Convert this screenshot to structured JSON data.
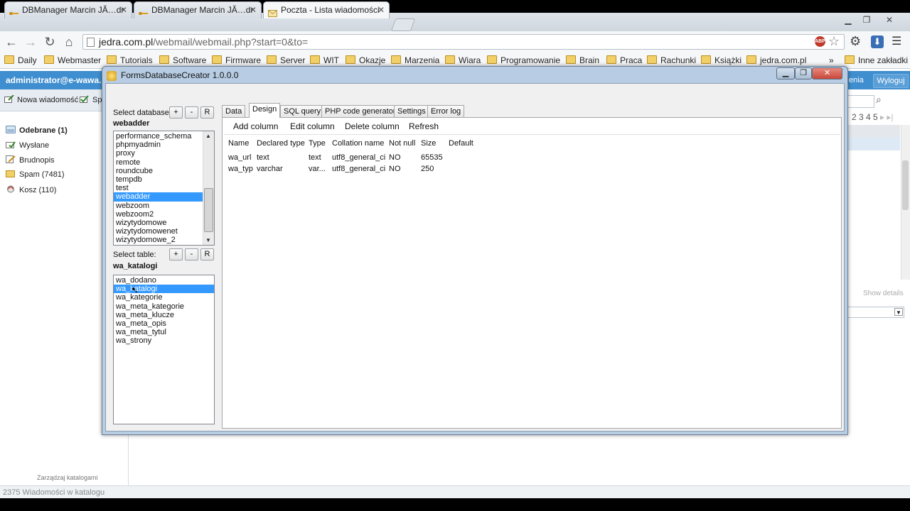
{
  "browser": {
    "tabs": [
      {
        "title": "DBManager Marcin JĂ…dr",
        "active": false
      },
      {
        "title": "DBManager Marcin JĂ…dr",
        "active": false
      },
      {
        "title": "Poczta - Lista wiadomości",
        "active": true
      }
    ],
    "url_host": "jedra.com.pl",
    "url_path": "/webmail/webmail.php?start=0&to=",
    "bookmarks": [
      "Daily",
      "Webmaster",
      "Tutorials",
      "Software",
      "Firmware",
      "Server",
      "WIT",
      "Okazje",
      "Marzenia",
      "Wiara",
      "Programowanie",
      "Brain",
      "Praca",
      "Rachunki",
      "Książki",
      "jedra.com.pl"
    ],
    "bookmarks_more": "»",
    "bookmarks_other": "Inne zakładki"
  },
  "webmail": {
    "account": "administrator@e-wawa.p",
    "logout": "Wyloguj",
    "settings_fragment": "enia",
    "new_message": "Nowa wiadomość",
    "send_fragment": "Sp",
    "folders": [
      {
        "label": "Odebrane (1)",
        "bold": true,
        "icon": "inbox-icon"
      },
      {
        "label": "Wysłane",
        "bold": false,
        "icon": "sent-icon"
      },
      {
        "label": "Brudnopis",
        "bold": false,
        "icon": "drafts-icon"
      },
      {
        "label": "Spam (7481)",
        "bold": false,
        "icon": "spam-folder-icon"
      },
      {
        "label": "Kosz (110)",
        "bold": false,
        "icon": "trash-icon"
      }
    ],
    "manage_folders": "Zarządzaj katalogami",
    "status": "2375 Wiadomości w katalogu",
    "pager": "2 3 4 5",
    "show_details": "Show details"
  },
  "dialog": {
    "title": "FormsDatabaseCreator 1.0.0.0",
    "select_database_label": "Select database:",
    "selected_database": "webadder",
    "databases": [
      "performance_schema",
      "phpmyadmin",
      "proxy",
      "remote",
      "roundcube",
      "tempdb",
      "test",
      "webadder",
      "webzoom",
      "webzoom2",
      "wizytydomowe",
      "wizytydomowenet",
      "wizytydomowe_2"
    ],
    "selected_database_index": 7,
    "select_table_label": "Select table:",
    "selected_table": "wa_katalogi",
    "tables": [
      "wa_dodano",
      "wa_katalogi",
      "wa_kategorie",
      "wa_meta_kategorie",
      "wa_meta_klucze",
      "wa_meta_opis",
      "wa_meta_tytul",
      "wa_strony"
    ],
    "selected_table_index": 1,
    "btn_add": "+",
    "btn_remove": "-",
    "btn_refresh": "R",
    "tabs": [
      "Data",
      "Design",
      "SQL query",
      "PHP code generator",
      "Settings",
      "Error log"
    ],
    "active_tab": "Design",
    "toolbar": [
      "Add column",
      "Edit column",
      "Delete column",
      "Refresh"
    ],
    "columns": [
      "Name",
      "Declared type",
      "Type",
      "Collation name",
      "Not null",
      "Size",
      "Default"
    ],
    "rows": [
      [
        "wa_url",
        "text",
        "text",
        "utf8_general_ci",
        "NO",
        "65535",
        ""
      ],
      [
        "wa_typ",
        "varchar",
        "var...",
        "utf8_general_ci",
        "NO",
        "250",
        ""
      ]
    ]
  },
  "colors": {
    "accent_blue": "#3f8ecf",
    "selection": "#3399ff",
    "dialog_frame": "#b8cde4",
    "close_button": "#c9473a"
  }
}
